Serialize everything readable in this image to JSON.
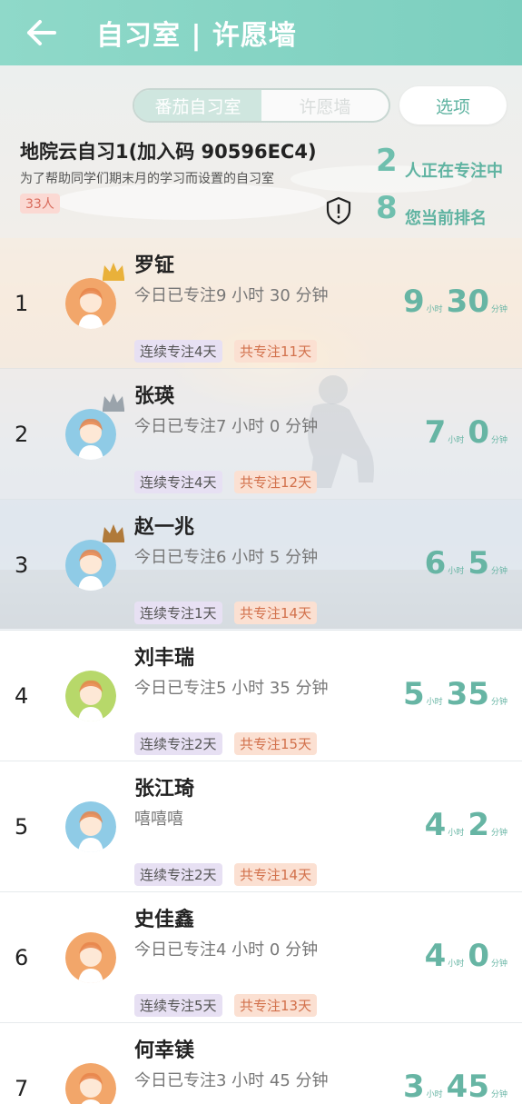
{
  "header": {
    "title": "自习室 | 许愿墙"
  },
  "tabs": [
    {
      "label": "番茄自习室",
      "active": true
    },
    {
      "label": "许愿墙",
      "active": false
    }
  ],
  "options_label": "选项",
  "room": {
    "name": "地院云自习1(加入码 90596EC4)",
    "description": "为了帮助同学们期末月的学习而设置的自习室",
    "member_count": "33人"
  },
  "stats": {
    "focusing_count": "2",
    "focusing_label": "人正在专注中",
    "my_rank": "8",
    "my_rank_label": "您当前排名"
  },
  "units": {
    "hour": "小时",
    "minute": "分钟"
  },
  "leaderboard": [
    {
      "rank": "1",
      "name": "罗钲",
      "status": "今日已专注9 小时 30 分钟",
      "hours": "9",
      "minutes": "30",
      "streak": "连续专注4天",
      "total": "共专注11天",
      "avatar_color": "#f2a66a",
      "crown": "gold"
    },
    {
      "rank": "2",
      "name": "张瑛",
      "status": "今日已专注7 小时 0 分钟",
      "hours": "7",
      "minutes": "0",
      "streak": "连续专注4天",
      "total": "共专注12天",
      "avatar_color": "#8fcbe6",
      "crown": "silver"
    },
    {
      "rank": "3",
      "name": "赵一兆",
      "status": "今日已专注6 小时 5 分钟",
      "hours": "6",
      "minutes": "5",
      "streak": "连续专注1天",
      "total": "共专注14天",
      "avatar_color": "#8fcbe6",
      "crown": "bronze"
    },
    {
      "rank": "4",
      "name": "刘丰瑞",
      "status": "今日已专注5 小时 35 分钟",
      "hours": "5",
      "minutes": "35",
      "streak": "连续专注2天",
      "total": "共专注15天",
      "avatar_color": "#b7d86a",
      "crown": ""
    },
    {
      "rank": "5",
      "name": "张江琦",
      "status": "嘻嘻嘻",
      "hours": "4",
      "minutes": "2",
      "streak": "连续专注2天",
      "total": "共专注14天",
      "avatar_color": "#8fcbe6",
      "crown": ""
    },
    {
      "rank": "6",
      "name": "史佳鑫",
      "status": "今日已专注4 小时 0 分钟",
      "hours": "4",
      "minutes": "0",
      "streak": "连续专注5天",
      "total": "共专注13天",
      "avatar_color": "#f2a66a",
      "crown": ""
    },
    {
      "rank": "7",
      "name": "何幸镁",
      "status": "今日已专注3 小时 45 分钟",
      "hours": "3",
      "minutes": "45",
      "streak": "",
      "total": "",
      "avatar_color": "#f2a66a",
      "crown": ""
    }
  ],
  "icons": {
    "back": "arrow-left-icon",
    "shield": "shield-alert-icon",
    "crown": "crown-icon"
  },
  "colors": {
    "accent": "#6fbfae",
    "header": "#8fd9c9",
    "streak_tag": "#e7e0f3",
    "total_tag": "#fbe0d2",
    "badge": "#fbd9d3"
  }
}
